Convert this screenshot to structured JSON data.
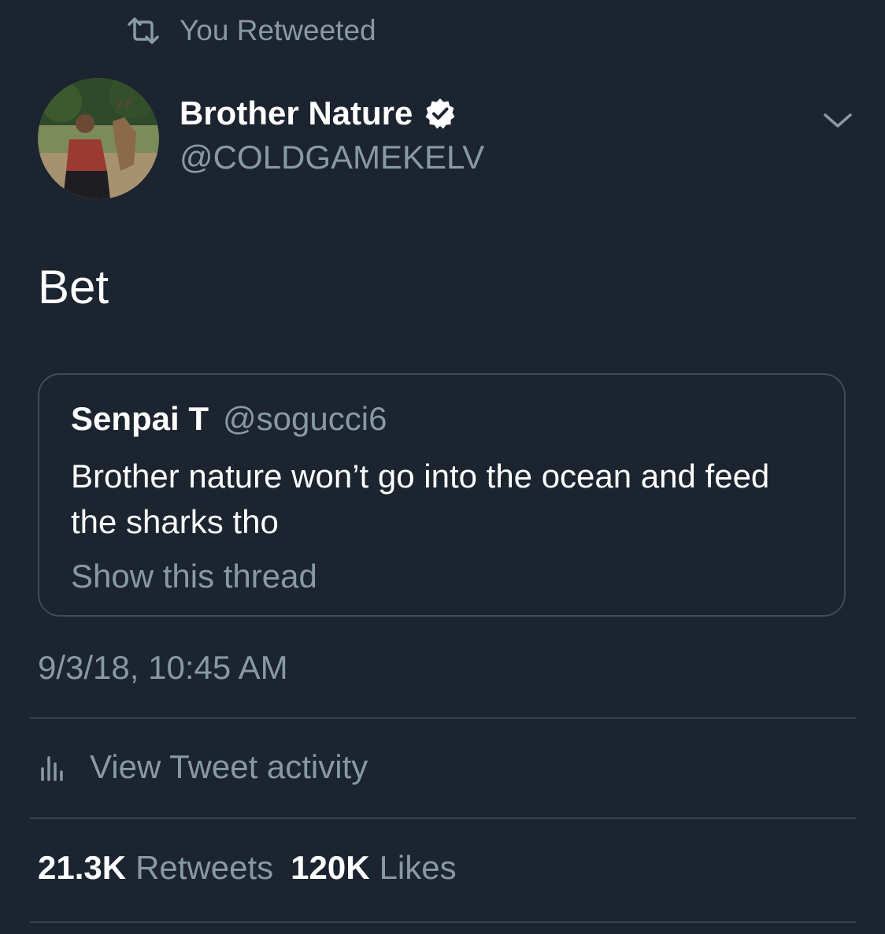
{
  "retweet_banner": {
    "label": "You Retweeted",
    "icon": "retweet-icon"
  },
  "author": {
    "name": "Brother Nature",
    "handle": "@COLDGAMEKELV",
    "verified": true
  },
  "tweet": {
    "text": "Bet"
  },
  "quoted_tweet": {
    "name": "Senpai T",
    "handle": "@sogucci6",
    "text": "Brother nature won’t go into the ocean and feed the sharks tho",
    "show_thread_label": "Show this thread"
  },
  "timestamp": "9/3/18, 10:45 AM",
  "activity": {
    "label": "View Tweet activity",
    "icon": "bar-chart-icon"
  },
  "stats": {
    "retweets_count": "21.3K",
    "retweets_label": "Retweets",
    "likes_count": "120K",
    "likes_label": "Likes"
  },
  "colors": {
    "background": "#1c2430",
    "muted_text": "#8899a6",
    "divider": "#38444d",
    "text": "#ffffff"
  }
}
